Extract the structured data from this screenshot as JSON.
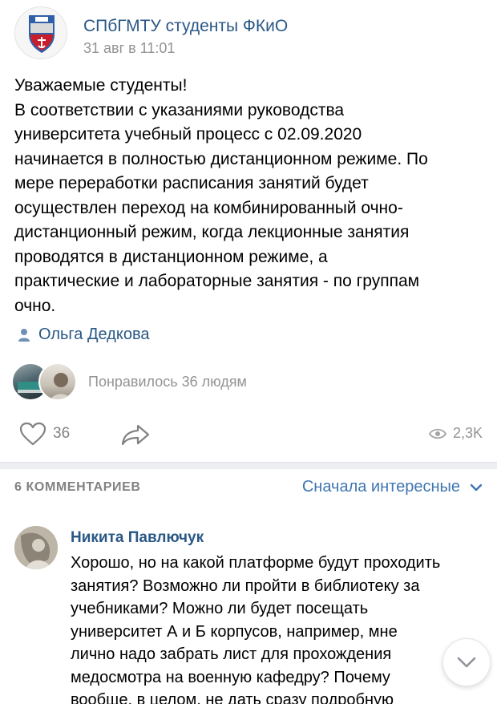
{
  "post": {
    "community_name": "СПбГМТУ студенты ФКиО",
    "date": "31 авг в 11:01",
    "text_lines": [
      "Уважаемые студенты!",
      "В соответствии с указаниями руководства",
      "университета учебный процесс с 02.09.2020",
      "начинается в полностью дистанционном режиме. По",
      "мере переработки расписания занятий будет",
      "осуществлен переход на комбинированный очно-",
      "дистанционный режим, когда лекционные занятия",
      "проводятся в дистанционном режиме, а",
      "практические и лабораторные занятия - по группам",
      "очно."
    ],
    "author": "Ольга Дедкова",
    "liked_by_text": "Понравилось 36 людям",
    "likes_count": "36",
    "views_count": "2,3K"
  },
  "comments_section": {
    "count_label": "6 КОММЕНТАРИЕВ",
    "sort_label": "Сначала интересные"
  },
  "comment": {
    "author": "Никита Павлючук",
    "text_lines": [
      "Хорошо, но на какой платформе будут проходить",
      "занятия? Возможно ли пройти в библиотеку за",
      "учебниками? Можно ли будет посещать",
      "университет А и Б корпусов, например, мне",
      "лично надо забрать лист для прохождения",
      "медосмотра на военную кафедру? Почему",
      "вообще, в целом, не дать сразу подробную"
    ]
  },
  "colors": {
    "link_blue": "#2a5885",
    "sort_blue": "#3f76b0",
    "meta_gray": "#939393",
    "separator": "#eceef1"
  },
  "icons": [
    "community-logo",
    "person-icon",
    "heart-icon",
    "share-arrow-icon",
    "eye-icon",
    "chevron-down-icon"
  ]
}
